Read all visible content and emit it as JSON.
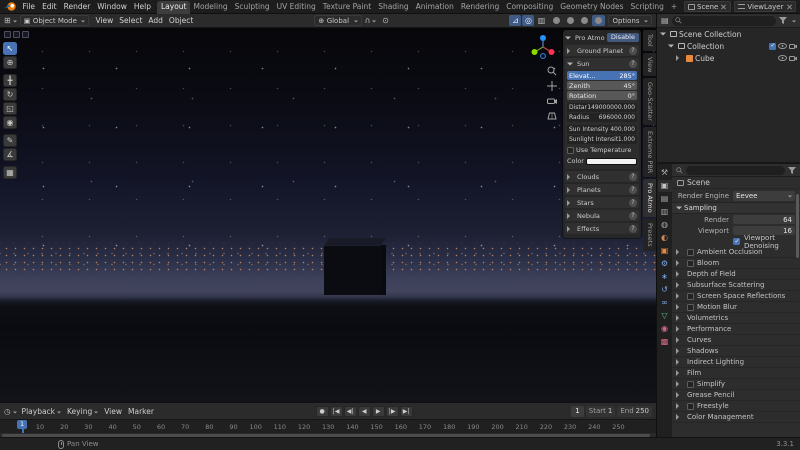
{
  "colors": {
    "accent": "#4772b3",
    "object_orange": "#e8883a"
  },
  "topbar": {
    "menus": [
      {
        "label": "File"
      },
      {
        "label": "Edit"
      },
      {
        "label": "Render"
      },
      {
        "label": "Window"
      },
      {
        "label": "Help"
      }
    ],
    "workspaces": [
      {
        "label": "Layout",
        "active": true
      },
      {
        "label": "Modeling"
      },
      {
        "label": "Sculpting"
      },
      {
        "label": "UV Editing"
      },
      {
        "label": "Texture Paint"
      },
      {
        "label": "Shading"
      },
      {
        "label": "Animation"
      },
      {
        "label": "Rendering"
      },
      {
        "label": "Compositing"
      },
      {
        "label": "Geometry Nodes"
      },
      {
        "label": "Scripting"
      },
      {
        "label": "+"
      }
    ],
    "scene": {
      "label": "Scene"
    },
    "viewlayer": {
      "label": "ViewLayer"
    }
  },
  "vp_header": {
    "mode": "Object Mode",
    "menus": [
      {
        "label": "View"
      },
      {
        "label": "Select"
      },
      {
        "label": "Add"
      },
      {
        "label": "Object"
      }
    ],
    "orientation": "Global",
    "snap_icon": "∩",
    "proportional_icon": "⊙",
    "toggles": [
      {
        "glyph": "⊿",
        "name": "show-gizmo",
        "pressed": true
      },
      {
        "glyph": "◎",
        "name": "show-overlays",
        "pressed": true
      },
      {
        "glyph": "▥",
        "name": "toggle-xray"
      }
    ],
    "shading": [
      {
        "name": "wireframe"
      },
      {
        "name": "solid"
      },
      {
        "name": "material-preview"
      },
      {
        "name": "rendered",
        "active": true
      }
    ],
    "options": "Options"
  },
  "tools": [
    {
      "glyph": "↖",
      "name": "select-box",
      "active": true
    },
    {
      "glyph": "⊕",
      "name": "cursor"
    },
    {
      "glyph": "╋",
      "name": "move",
      "gap": true
    },
    {
      "glyph": "↻",
      "name": "rotate"
    },
    {
      "glyph": "◱",
      "name": "scale"
    },
    {
      "glyph": "◉",
      "name": "transform"
    },
    {
      "glyph": "✎",
      "name": "annotate",
      "gap": true
    },
    {
      "glyph": "∡",
      "name": "measure"
    },
    {
      "glyph": "▦",
      "name": "add-cube",
      "gap": true
    }
  ],
  "npanel": {
    "title": "Pro Atmo",
    "disable_label": "Disable",
    "groups_before": [
      {
        "label": "Ground Planet"
      }
    ],
    "sun": {
      "title": "Sun",
      "sliders": [
        {
          "label": "Elevat...",
          "value": "285°"
        },
        {
          "label": "Zenith",
          "value": "45°"
        },
        {
          "label": "Rotation",
          "value": "0°"
        }
      ],
      "fields": [
        {
          "label": "Distan",
          "value": "149000000.000"
        },
        {
          "label": "Radius",
          "value": "696000.000"
        }
      ],
      "intensities": [
        {
          "label": "Sun Intensity",
          "value": "400.000"
        },
        {
          "label": "Sunlight Intensity",
          "value": "1.000"
        }
      ],
      "use_temperature_label": "Use Temperature",
      "color_label": "Color"
    },
    "groups_after": [
      {
        "label": "Clouds"
      },
      {
        "label": "Planets"
      },
      {
        "label": "Stars"
      },
      {
        "label": "Nebula"
      },
      {
        "label": "Effects"
      }
    ],
    "tabs": [
      {
        "label": "Tool"
      },
      {
        "label": "View"
      },
      {
        "label": "Geo-Scatter"
      },
      {
        "label": "Extreme PBR"
      },
      {
        "label": "Pro Atmo",
        "active": true
      },
      {
        "label": "Presets"
      }
    ]
  },
  "outliner": {
    "rows": [
      {
        "label": "Scene Collection"
      },
      {
        "label": "Collection"
      },
      {
        "label": "Cube"
      }
    ]
  },
  "properties": {
    "breadcrumb": "Scene",
    "engine_label": "Render Engine",
    "engine_value": "Eevee",
    "sampling": {
      "title": "Sampling",
      "rows": [
        {
          "label": "Render",
          "value": "64"
        },
        {
          "label": "Viewport",
          "value": "16"
        }
      ],
      "denoise_label": "Viewport Denoising"
    },
    "sections": [
      {
        "label": "Ambient Occlusion",
        "checkbox": true
      },
      {
        "label": "Bloom",
        "checkbox": true
      },
      {
        "label": "Depth of Field"
      },
      {
        "label": "Subsurface Scattering"
      },
      {
        "label": "Screen Space Reflections",
        "checkbox": true
      },
      {
        "label": "Motion Blur",
        "checkbox": true
      },
      {
        "label": "Volumetrics"
      },
      {
        "label": "Performance"
      },
      {
        "label": "Curves"
      },
      {
        "label": "Shadows"
      },
      {
        "label": "Indirect Lighting"
      },
      {
        "label": "Film"
      },
      {
        "label": "Simplify",
        "checkbox": true
      },
      {
        "label": "Grease Pencil"
      },
      {
        "label": "Freestyle",
        "checkbox": true
      },
      {
        "label": "Color Management"
      }
    ],
    "tabs": [
      {
        "glyph": "⚒",
        "name": "tool",
        "color": "#a8a8a8"
      },
      {
        "glyph": "▣",
        "name": "render",
        "color": "#c4c4c4",
        "active": true
      },
      {
        "glyph": "▤",
        "name": "output",
        "color": "#a8a8a8"
      },
      {
        "glyph": "▥",
        "name": "view-layer",
        "color": "#a8a8a8"
      },
      {
        "glyph": "◍",
        "name": "scene",
        "color": "#a8a8a8"
      },
      {
        "glyph": "◐",
        "name": "world",
        "color": "#c98a5a"
      },
      {
        "glyph": "▣",
        "name": "object",
        "color": "#e8883a"
      },
      {
        "glyph": "⚙",
        "name": "modifiers",
        "color": "#7aa9e8"
      },
      {
        "glyph": "∗",
        "name": "particles",
        "color": "#7aa9e8"
      },
      {
        "glyph": "↺",
        "name": "physics",
        "color": "#7aa9e8"
      },
      {
        "glyph": "∞",
        "name": "constraints",
        "color": "#7aa9e8"
      },
      {
        "glyph": "▽",
        "name": "object-data",
        "color": "#58c08a"
      },
      {
        "glyph": "◉",
        "name": "material",
        "color": "#d46a84"
      },
      {
        "glyph": "▩",
        "name": "texture",
        "color": "#d46a84"
      }
    ]
  },
  "timeline": {
    "menus": [
      {
        "label": "Playback",
        "caret": true
      },
      {
        "label": "Keying",
        "caret": true
      },
      {
        "label": "View"
      },
      {
        "label": "Marker"
      }
    ],
    "transport": [
      {
        "glyph": "●",
        "name": "auto-keying"
      },
      {
        "glyph": "|◀",
        "name": "jump-to-start"
      },
      {
        "glyph": "◀|",
        "name": "previous-keyframe"
      },
      {
        "glyph": "◀",
        "name": "play-reverse"
      },
      {
        "glyph": "▶",
        "name": "play"
      },
      {
        "glyph": "|▶",
        "name": "next-keyframe"
      },
      {
        "glyph": "▶|",
        "name": "jump-to-end"
      }
    ],
    "current_frame": "1",
    "start_label": "Start",
    "start_value": "1",
    "end_label": "End",
    "end_value": "250",
    "playhead": "1",
    "ticks": [
      "10",
      "20",
      "30",
      "40",
      "50",
      "60",
      "70",
      "80",
      "90",
      "100",
      "110",
      "120",
      "130",
      "140",
      "150",
      "160",
      "170",
      "180",
      "190",
      "200",
      "210",
      "220",
      "230",
      "240",
      "250"
    ]
  },
  "statusbar": {
    "hint": "Pan View",
    "version": "3.3.1"
  }
}
